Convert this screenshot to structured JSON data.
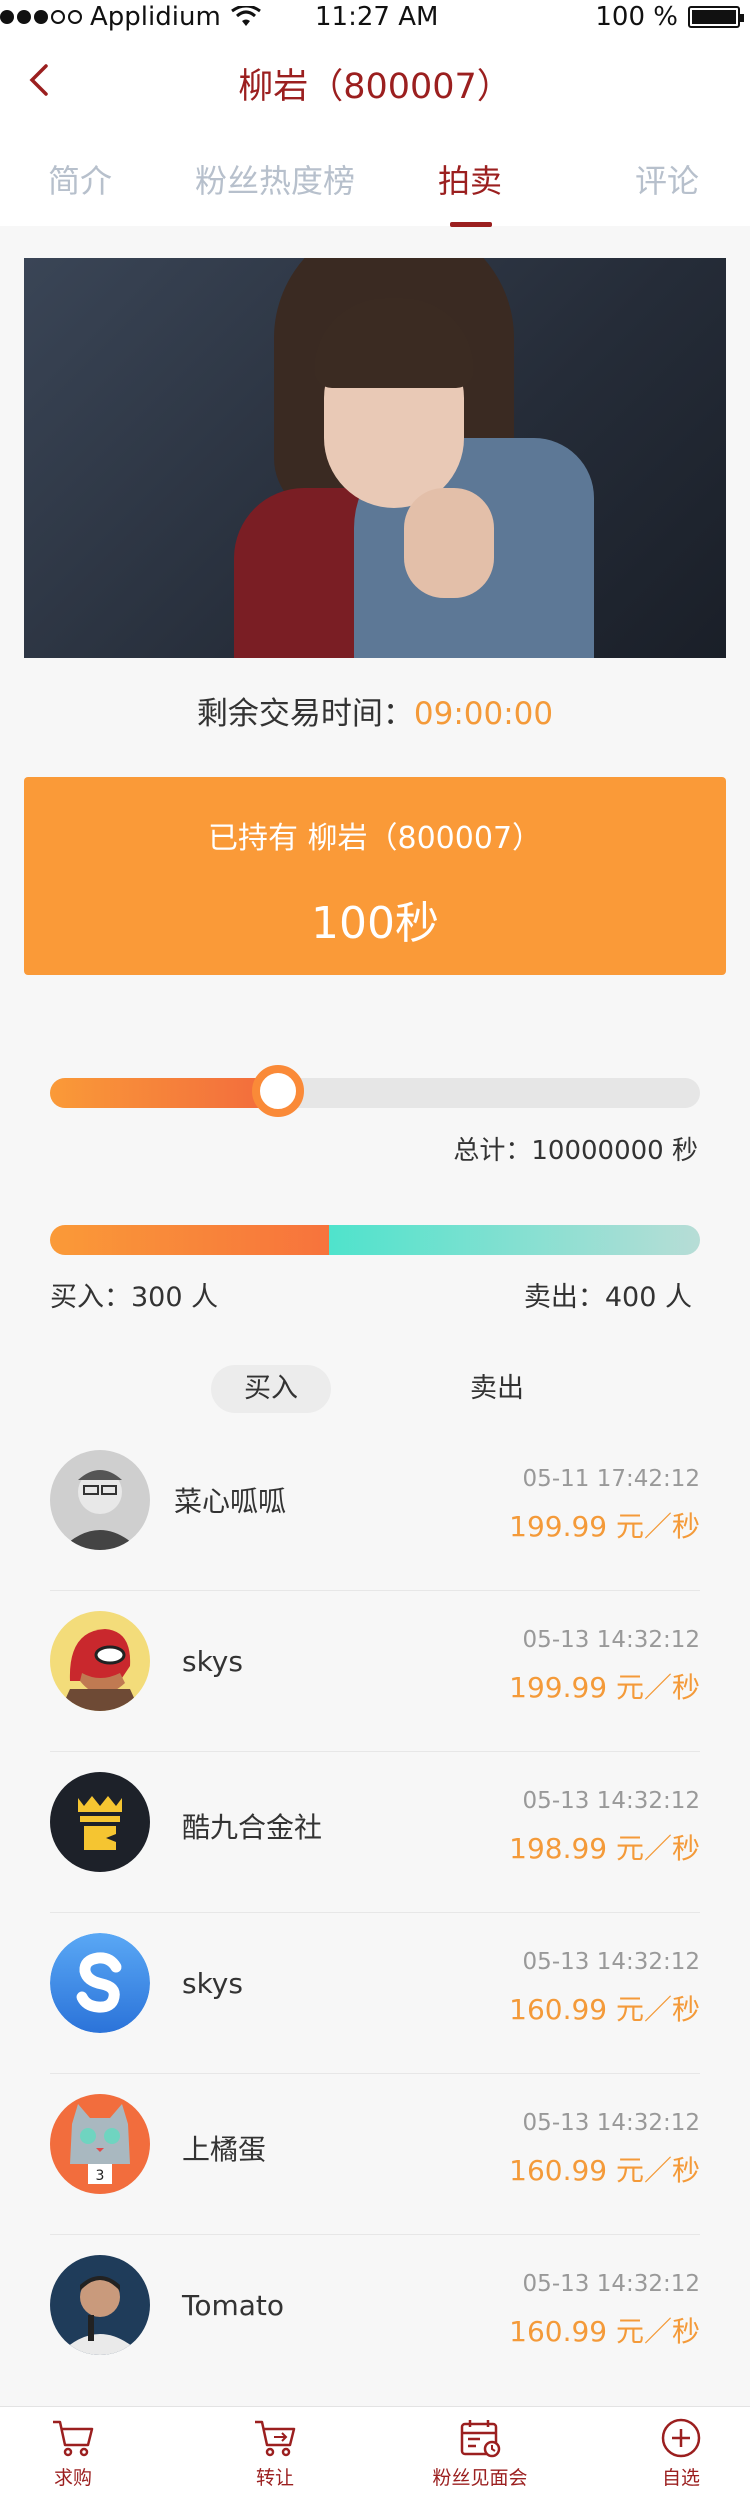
{
  "status_bar": {
    "carrier": "Applidium",
    "time": "11:27 AM",
    "battery": "100 %"
  },
  "nav": {
    "title": "柳岩（800007）"
  },
  "tabs": [
    {
      "label": "简介"
    },
    {
      "label": "粉丝热度榜"
    },
    {
      "label": "拍卖"
    },
    {
      "label": "评论"
    }
  ],
  "auction": {
    "remaining_label": "剩余交易时间：",
    "remaining_time": "09:00:00",
    "holding_text": "已持有 柳岩（800007）",
    "holding_amount": "100秒",
    "total_text": "总计：10000000 秒",
    "slider_fraction": 0.35,
    "buy_text": "买入：300 人",
    "sell_text": "卖出：400 人",
    "buy_count": 300,
    "sell_count": 400
  },
  "segments": {
    "buy": "买入",
    "sell": "卖出"
  },
  "trades": [
    {
      "name": "菜心呱呱",
      "time": "05-11  17:42:12",
      "price": "199.99 元／秒",
      "avatar": "person-gray"
    },
    {
      "name": "skys",
      "time": "05-13 14:32:12",
      "price": "199.99 元／秒",
      "avatar": "hero-mask"
    },
    {
      "name": "酷九合金社",
      "time": "05-13 14:32:12",
      "price": "198.99 元／秒",
      "avatar": "crown-logo"
    },
    {
      "name": "skys",
      "time": "05-13 14:32:12",
      "price": "160.99 元／秒",
      "avatar": "s-logo"
    },
    {
      "name": "上橘蛋",
      "time": "05-13 14:32:12",
      "price": "160.99 元／秒",
      "avatar": "cat-face"
    },
    {
      "name": "Tomato",
      "time": "05-13 14:32:12",
      "price": "160.99 元／秒",
      "avatar": "person-mic"
    }
  ],
  "tabbar": [
    {
      "label": "求购",
      "icon": "cart-icon"
    },
    {
      "label": "转让",
      "icon": "cart-transfer-icon"
    },
    {
      "label": "粉丝见面会",
      "icon": "calendar-icon"
    },
    {
      "label": "自选",
      "icon": "plus-circle-icon"
    }
  ],
  "colors": {
    "brand": "#9b1f1f",
    "accent": "#fa9a38",
    "sell": "#4fe3cc"
  }
}
